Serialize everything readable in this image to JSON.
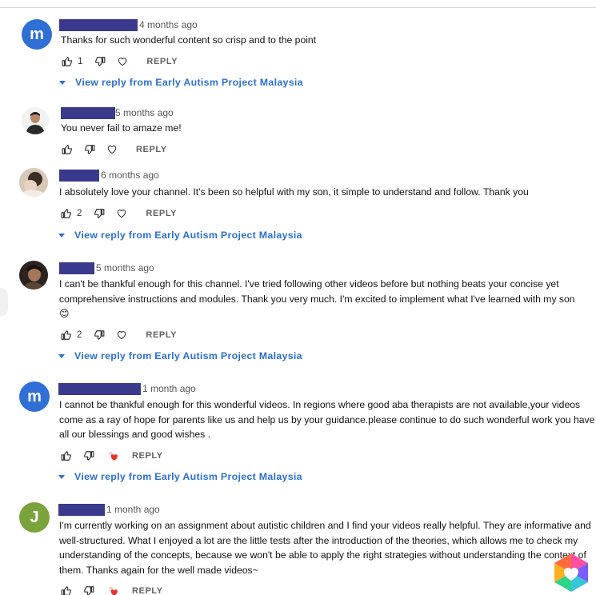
{
  "comments": [
    {
      "time": "4 months ago",
      "avatar_letter": "m",
      "avatar_color": "#2f6fd6",
      "text": "Thanks for such wonderful content so crisp and to the point",
      "likes": "1",
      "reply_label": "REPLY",
      "view_reply": "View reply from Early Autism Project Malaysia"
    },
    {
      "time": "5 months ago",
      "text": "You never fail to amaze me!",
      "reply_label": "REPLY"
    },
    {
      "time": "6 months ago",
      "text": "I absolutely love your channel. It's been so helpful with my son, it simple to understand and follow. Thank you",
      "likes": "2",
      "reply_label": "REPLY",
      "view_reply": "View reply from Early Autism Project Malaysia"
    },
    {
      "time": "5 months ago",
      "text": "I can't be thankful enough for this channel. I've tried following other videos before but nothing beats your concise yet comprehensive instructions and modules. Thank you very much. I'm excited to implement what I've learned with my son",
      "emoji": "😊",
      "likes": "2",
      "reply_label": "REPLY",
      "view_reply": "View reply from Early Autism Project Malaysia"
    },
    {
      "time": "1 month ago",
      "avatar_letter": "m",
      "avatar_color": "#2f6fd6",
      "text": "I cannot be thankful enough for this wonderful videos. In regions where good aba therapists are not available,your videos come as a ray of hope for parents like us  and help us by your guidance.please continue to do such wonderful work you have all our blessings and good  wishes .",
      "reply_label": "REPLY",
      "view_reply": "View reply from Early Autism Project Malaysia"
    },
    {
      "time": "1 month ago",
      "avatar_letter": "J",
      "avatar_color": "#7aa33b",
      "text": "I'm currently working on an assignment about autistic children and I find your videos really helpful. They are informative and well-structured. What I enjoyed a lot are the little tests after the introduction of the theories, which allows me to check my understanding of the concepts, because we won't be able to apply the right strategies without understanding the context of them. Thanks again for the well made videos~",
      "reply_label": "REPLY"
    }
  ],
  "colors": {
    "link": "#2b6fd1",
    "name_redaction": "#3a3a8c"
  },
  "icons": [
    "thumbs-up-icon",
    "thumbs-down-icon",
    "heart-icon",
    "creator-heart-icon",
    "expand-caret-icon",
    "watermark-logo-icon"
  ]
}
